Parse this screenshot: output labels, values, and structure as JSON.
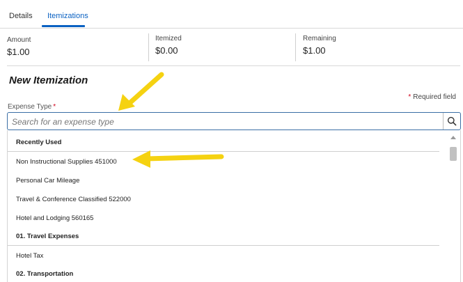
{
  "tabs": [
    {
      "label": "Details",
      "active": false
    },
    {
      "label": "Itemizations",
      "active": true
    }
  ],
  "summary": {
    "amount_label": "Amount",
    "amount_value": "$1.00",
    "itemized_label": "Itemized",
    "itemized_value": "$0.00",
    "remaining_label": "Remaining",
    "remaining_value": "$1.00"
  },
  "section_title": "New Itemization",
  "required_note": "Required field",
  "expense_type_label": "Expense Type",
  "search": {
    "placeholder": "Search for an expense type",
    "value": ""
  },
  "dropdown": {
    "rows": [
      {
        "text": "Recently Used",
        "kind": "header"
      },
      {
        "text": "Non Instructional Supplies 451000",
        "kind": "option"
      },
      {
        "text": "Personal Car Mileage",
        "kind": "option"
      },
      {
        "text": "Travel & Conference Classified 522000",
        "kind": "option"
      },
      {
        "text": "Hotel and Lodging 560165",
        "kind": "option"
      },
      {
        "text": "01. Travel Expenses",
        "kind": "header"
      },
      {
        "text": "Hotel Tax",
        "kind": "option"
      },
      {
        "text": "02. Transportation",
        "kind": "header"
      }
    ]
  },
  "icons": {
    "search": "search-icon",
    "scroll_up": "scroll-up-icon",
    "annotation_arrow": "arrow-annotation-icon"
  },
  "colors": {
    "accent": "#0a61c2",
    "required": "#d0021b",
    "annotation": "#f5d211"
  }
}
